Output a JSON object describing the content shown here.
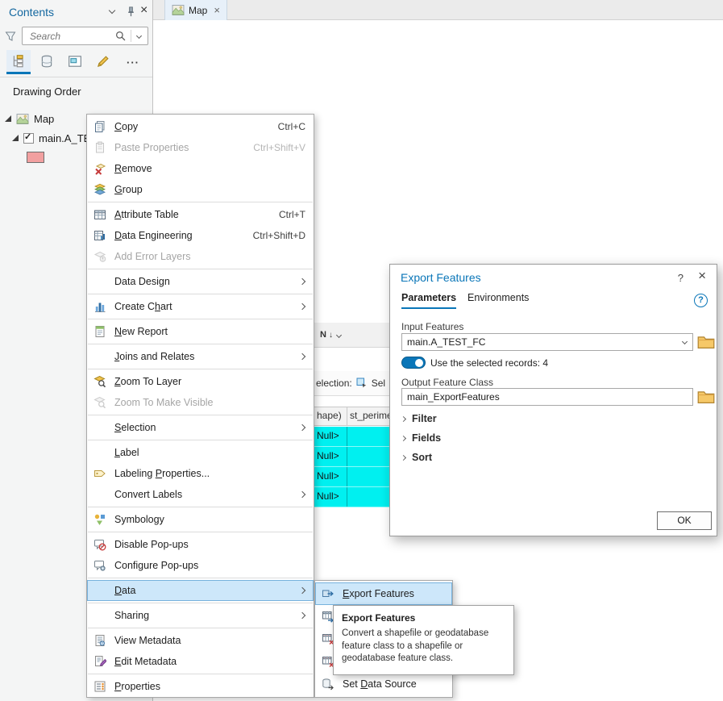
{
  "colors": {
    "accent_blue": "#0a76b8",
    "selection_cyan": "#00f0f0",
    "menu_highlight": "#cde7fa",
    "layer_symbol_fill": "#f2a0a0",
    "title_blue": "#1468a0"
  },
  "contents": {
    "title": "Contents",
    "search_placeholder": "Search",
    "drawing_order_label": "Drawing Order",
    "map_item": "Map",
    "layer_item": "main.A_TEST_FC",
    "layer_checked": true,
    "toolbar": [
      {
        "icon": "list-by-drawing-order-icon",
        "selected": true
      },
      {
        "icon": "list-by-data-source-icon"
      },
      {
        "icon": "list-by-selection-icon"
      },
      {
        "icon": "list-by-editing-icon"
      }
    ]
  },
  "view_tab": {
    "label": "Map"
  },
  "attribute_table": {
    "sort_chip": "N",
    "status_left_fragment": "election:",
    "status_right_fragment": "Sel",
    "columns": [
      "hape)",
      "st_perime"
    ],
    "selected_rows": [
      "Null>",
      "Null>",
      "Null>",
      "Null>"
    ]
  },
  "context_menu": {
    "items": [
      {
        "label": "Copy",
        "icon": "copy-icon",
        "shortcut": "Ctrl+C",
        "u": 0
      },
      {
        "label": "Paste Properties",
        "icon": "paste-properties-icon",
        "shortcut": "Ctrl+Shift+V",
        "disabled": true
      },
      {
        "label": "Remove",
        "icon": "remove-icon",
        "u": 0
      },
      {
        "label": "Group",
        "icon": "group-icon",
        "u": 0
      },
      {
        "sep": true
      },
      {
        "label": "Attribute Table",
        "icon": "attribute-table-icon",
        "shortcut": "Ctrl+T",
        "u": 0
      },
      {
        "label": "Data Engineering",
        "icon": "data-engineering-icon",
        "shortcut": "Ctrl+Shift+D",
        "u": 0
      },
      {
        "label": "Add Error Layers",
        "icon": "add-error-layers-icon",
        "disabled": true
      },
      {
        "sep": true
      },
      {
        "label": "Data Design",
        "submenu": true
      },
      {
        "sep": true
      },
      {
        "label": "Create Chart",
        "icon": "create-chart-icon",
        "submenu": true,
        "u": 8
      },
      {
        "sep": true
      },
      {
        "label": "New Report",
        "icon": "new-report-icon",
        "u": 0
      },
      {
        "sep": true
      },
      {
        "label": "Joins and Relates",
        "submenu": true,
        "u": 0
      },
      {
        "sep": true
      },
      {
        "label": "Zoom To Layer",
        "icon": "zoom-to-layer-icon",
        "u": 0
      },
      {
        "label": "Zoom To Make Visible",
        "icon": "zoom-to-make-visible-icon",
        "disabled": true
      },
      {
        "sep": true
      },
      {
        "label": "Selection",
        "submenu": true,
        "u": 0
      },
      {
        "sep": true
      },
      {
        "label": "Label",
        "u": 0
      },
      {
        "label": "Labeling Properties...",
        "icon": "labeling-properties-icon",
        "u": 9
      },
      {
        "label": "Convert Labels",
        "submenu": true
      },
      {
        "sep": true
      },
      {
        "label": "Symbology",
        "icon": "symbology-icon"
      },
      {
        "sep": true
      },
      {
        "label": "Disable Pop-ups",
        "icon": "disable-popups-icon"
      },
      {
        "label": "Configure Pop-ups",
        "icon": "configure-popups-icon"
      },
      {
        "sep": true
      },
      {
        "label": "Data",
        "submenu": true,
        "highlighted": true,
        "u": 0
      },
      {
        "sep": true
      },
      {
        "label": "Sharing",
        "submenu": true
      },
      {
        "sep": true
      },
      {
        "label": "View Metadata",
        "icon": "view-metadata-icon"
      },
      {
        "label": "Edit Metadata",
        "icon": "edit-metadata-icon",
        "u": 0
      },
      {
        "sep": true
      },
      {
        "label": "Properties",
        "icon": "properties-icon",
        "u": 0
      }
    ]
  },
  "data_submenu": {
    "items": [
      {
        "label": "Export Features",
        "icon": "export-features-icon",
        "highlighted": true,
        "u": 0
      },
      {
        "label": "",
        "icon": "export-table-icon"
      },
      {
        "label": "",
        "icon": "covered-item-icon"
      },
      {
        "label": "",
        "icon": "covered-item-icon"
      },
      {
        "label": "Set Data Source",
        "icon": "set-data-source-icon",
        "u": 4
      }
    ]
  },
  "tooltip": {
    "title": "Export Features",
    "body": "Convert a shapefile or geodatabase feature class to a shapefile or geodatabase feature class."
  },
  "export_dialog": {
    "title": "Export Features",
    "tabs": [
      {
        "label": "Parameters",
        "active": true
      },
      {
        "label": "Environments"
      }
    ],
    "input_features_label": "Input Features",
    "input_features_value": "main.A_TEST_FC",
    "toggle_label": "Use the selected records: 4",
    "toggle_on": true,
    "output_label": "Output Feature Class",
    "output_value": "main_ExportFeatures",
    "sections": [
      "Filter",
      "Fields",
      "Sort"
    ],
    "ok_label": "OK"
  }
}
